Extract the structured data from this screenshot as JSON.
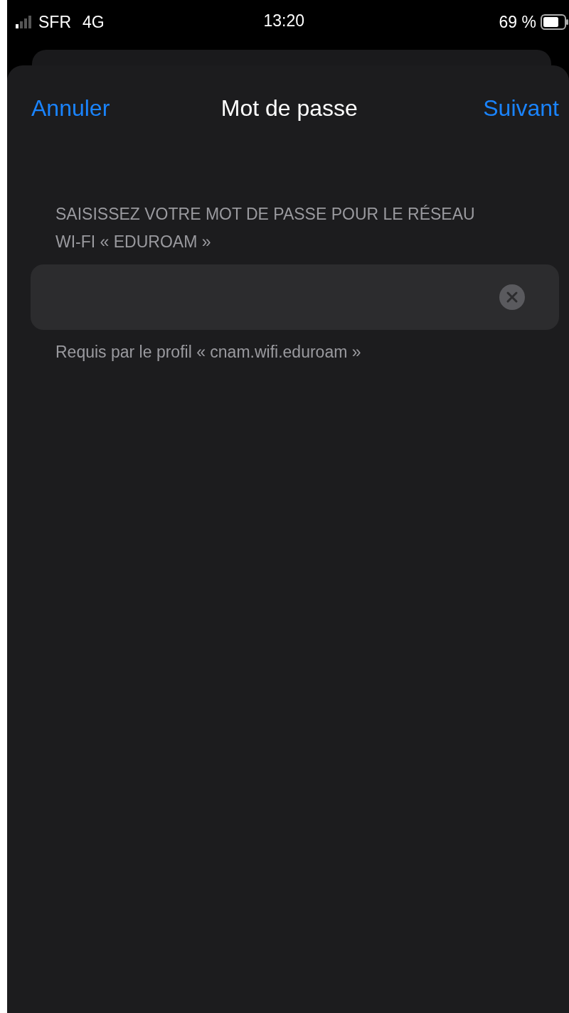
{
  "status_bar": {
    "carrier": "SFR",
    "network": "4G",
    "time": "13:20",
    "battery": "69 %"
  },
  "nav": {
    "cancel": "Annuler",
    "title": "Mot de passe",
    "next": "Suivant"
  },
  "section_header": "SAISISSEZ VOTRE MOT DE PASSE POUR LE RÉSEAU WI-FI « EDUROAM »",
  "password_field": {
    "clear_button": true
  },
  "footer": "Requis par le profil « cnam.wifi.eduroam »"
}
